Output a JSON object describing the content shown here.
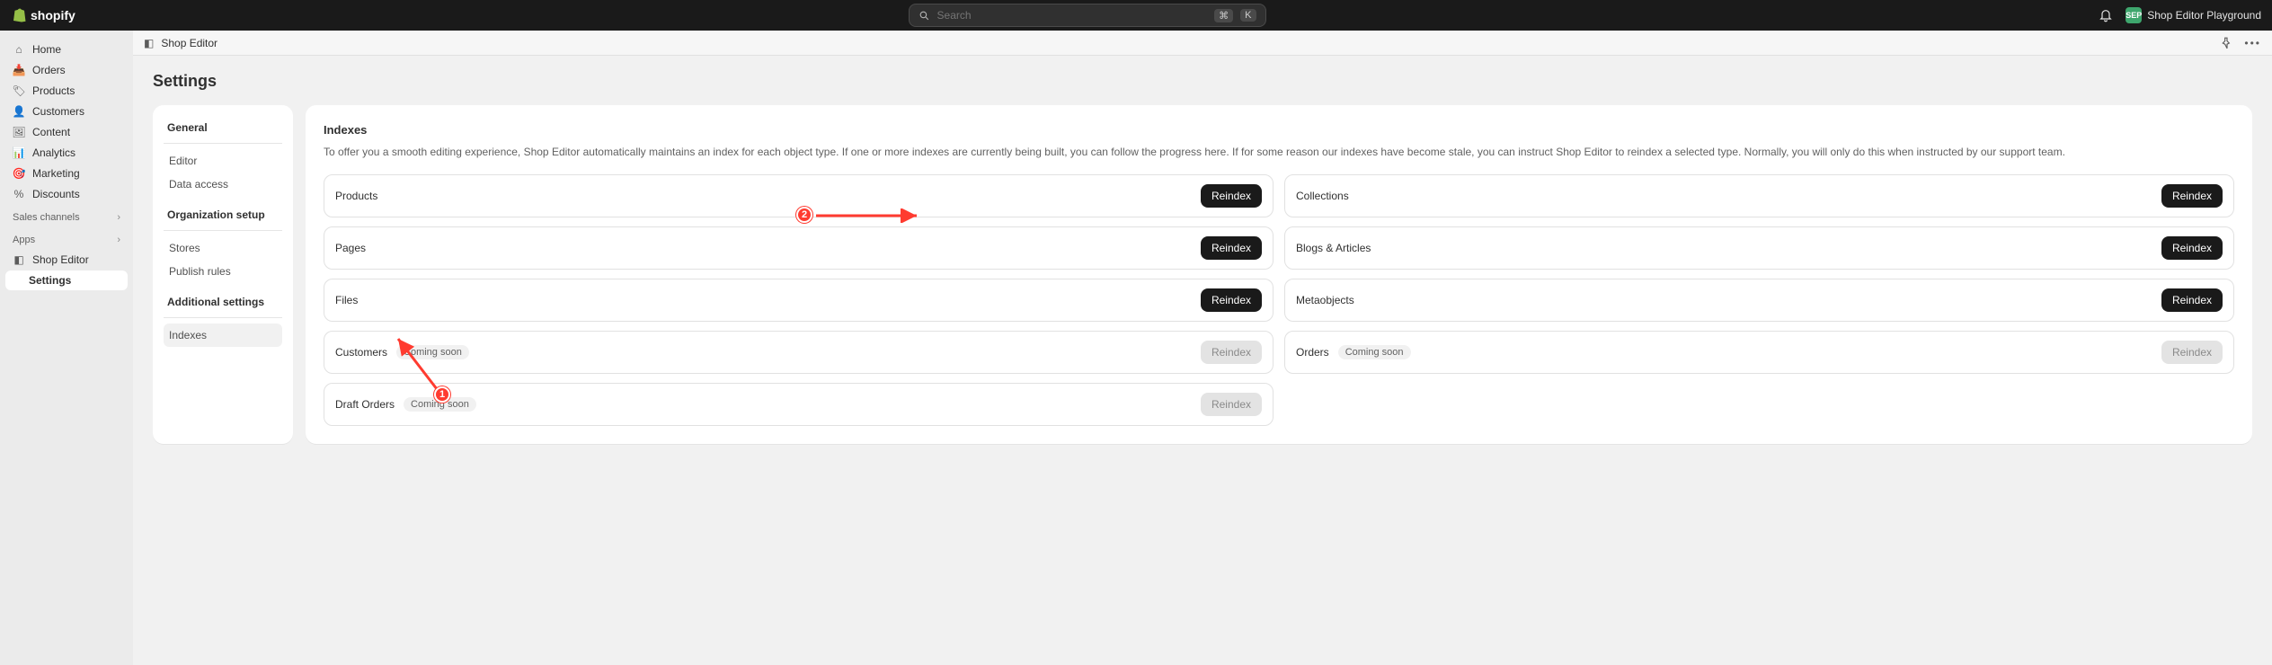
{
  "topbar": {
    "brand": "shopify",
    "search_placeholder": "Search",
    "kbd1": "⌘",
    "kbd2": "K",
    "account_initials": "SEP",
    "account_name": "Shop Editor Playground"
  },
  "sidebar": {
    "items": [
      {
        "icon": "home",
        "label": "Home"
      },
      {
        "icon": "orders",
        "label": "Orders"
      },
      {
        "icon": "products",
        "label": "Products"
      },
      {
        "icon": "customers",
        "label": "Customers"
      },
      {
        "icon": "content",
        "label": "Content"
      },
      {
        "icon": "analytics",
        "label": "Analytics"
      },
      {
        "icon": "marketing",
        "label": "Marketing"
      },
      {
        "icon": "discounts",
        "label": "Discounts"
      }
    ],
    "sales_channels": "Sales channels",
    "apps": "Apps",
    "app_item": "Shop Editor",
    "app_sub": "Settings"
  },
  "crumb": {
    "title": "Shop Editor"
  },
  "page": {
    "title": "Settings",
    "side_groups": [
      {
        "heading": "General",
        "items": [
          "Editor",
          "Data access"
        ]
      },
      {
        "heading": "Organization setup",
        "items": [
          "Stores",
          "Publish rules"
        ]
      },
      {
        "heading": "Additional settings",
        "items": [
          "Indexes"
        ]
      }
    ],
    "active_side_item": "Indexes",
    "panel": {
      "title": "Indexes",
      "desc": "To offer you a smooth editing experience, Shop Editor automatically maintains an index for each object type. If one or more indexes are currently being built, you can follow the progress here. If for some reason our indexes have become stale, you can instruct Shop Editor to reindex a selected type. Normally, you will only do this when instructed by our support team.",
      "button_label": "Reindex",
      "coming_soon_label": "Coming soon",
      "cards": [
        {
          "label": "Products",
          "disabled": false
        },
        {
          "label": "Collections",
          "disabled": false
        },
        {
          "label": "Pages",
          "disabled": false
        },
        {
          "label": "Blogs & Articles",
          "disabled": false
        },
        {
          "label": "Files",
          "disabled": false
        },
        {
          "label": "Metaobjects",
          "disabled": false
        },
        {
          "label": "Customers",
          "disabled": true,
          "coming": true
        },
        {
          "label": "Orders",
          "disabled": true,
          "coming": true
        },
        {
          "label": "Draft Orders",
          "disabled": true,
          "coming": true,
          "full": true
        }
      ]
    }
  },
  "annotations": {
    "a1": "1",
    "a2": "2"
  }
}
